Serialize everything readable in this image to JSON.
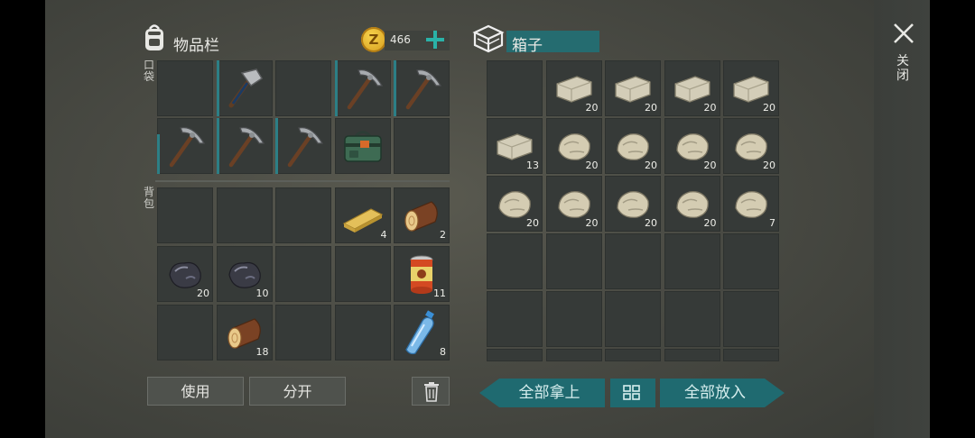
{
  "inventory": {
    "title": "物品栏",
    "coins": "466",
    "pocket_label": "口袋",
    "backpack_label": "背包",
    "pocket_slots": [
      {
        "icon": "empty",
        "count": ""
      },
      {
        "icon": "hammer",
        "count": ""
      },
      {
        "icon": "empty",
        "count": ""
      },
      {
        "icon": "pickaxe",
        "count": ""
      },
      {
        "icon": "pickaxe",
        "count": ""
      },
      {
        "icon": "pickaxe",
        "count": ""
      },
      {
        "icon": "pickaxe",
        "count": ""
      },
      {
        "icon": "pickaxe",
        "count": ""
      },
      {
        "icon": "toolbag",
        "count": ""
      },
      {
        "icon": "empty",
        "count": ""
      }
    ],
    "backpack_slots": [
      {
        "icon": "empty",
        "count": ""
      },
      {
        "icon": "empty",
        "count": ""
      },
      {
        "icon": "empty",
        "count": ""
      },
      {
        "icon": "plank",
        "count": "4"
      },
      {
        "icon": "log",
        "count": "2"
      },
      {
        "icon": "coal",
        "count": "20"
      },
      {
        "icon": "coal",
        "count": "10"
      },
      {
        "icon": "empty",
        "count": ""
      },
      {
        "icon": "empty",
        "count": ""
      },
      {
        "icon": "can",
        "count": "11"
      },
      {
        "icon": "empty",
        "count": ""
      },
      {
        "icon": "log",
        "count": "18"
      },
      {
        "icon": "empty",
        "count": ""
      },
      {
        "icon": "empty",
        "count": ""
      },
      {
        "icon": "bottle",
        "count": "8"
      }
    ],
    "use_label": "使用",
    "split_label": "分开"
  },
  "box": {
    "title": "箱子",
    "slots": [
      {
        "icon": "empty",
        "count": ""
      },
      {
        "icon": "brick",
        "count": "20"
      },
      {
        "icon": "brick",
        "count": "20"
      },
      {
        "icon": "brick",
        "count": "20"
      },
      {
        "icon": "brick",
        "count": "20"
      },
      {
        "icon": "brick",
        "count": "13"
      },
      {
        "icon": "stone",
        "count": "20"
      },
      {
        "icon": "stone",
        "count": "20"
      },
      {
        "icon": "stone",
        "count": "20"
      },
      {
        "icon": "stone",
        "count": "20"
      },
      {
        "icon": "stone",
        "count": "20"
      },
      {
        "icon": "stone",
        "count": "20"
      },
      {
        "icon": "stone",
        "count": "20"
      },
      {
        "icon": "stone",
        "count": "20"
      },
      {
        "icon": "stone",
        "count": "7"
      }
    ],
    "take_all_label": "全部拿上",
    "put_all_label": "全部放入"
  },
  "close_label": "关闭"
}
